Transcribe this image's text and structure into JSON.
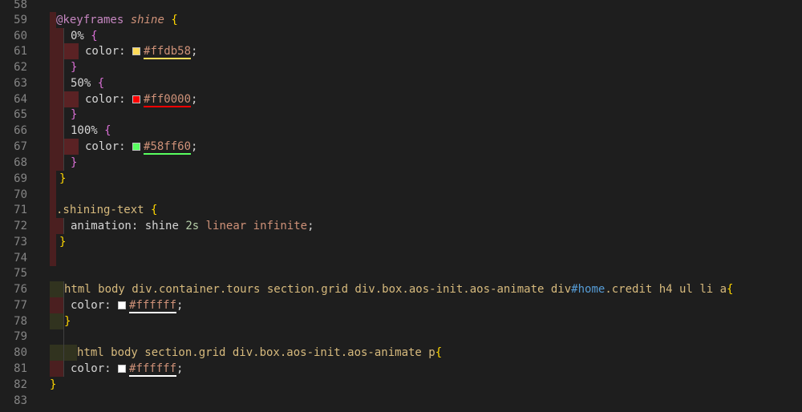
{
  "editor": {
    "lines": [
      {
        "n": "58"
      },
      {
        "n": "59",
        "t": {
          "at": "@keyframes",
          "name": "shine",
          "open": "{"
        }
      },
      {
        "n": "60",
        "t": {
          "sel": "0%",
          "open": "{"
        }
      },
      {
        "n": "61",
        "t": {
          "prop": "color:",
          "value": "#ffdb58",
          "semi": ";"
        }
      },
      {
        "n": "62",
        "t": {
          "close": "}"
        }
      },
      {
        "n": "63",
        "t": {
          "sel": "50%",
          "open": "{"
        }
      },
      {
        "n": "64",
        "t": {
          "prop": "color:",
          "value": "#ff0000",
          "semi": ";"
        }
      },
      {
        "n": "65",
        "t": {
          "close": "}"
        }
      },
      {
        "n": "66",
        "t": {
          "sel": "100%",
          "open": "{"
        }
      },
      {
        "n": "67",
        "t": {
          "prop": "color:",
          "value": "#58ff60",
          "semi": ";"
        }
      },
      {
        "n": "68",
        "t": {
          "close": "}"
        }
      },
      {
        "n": "69",
        "t": {
          "close": "}"
        }
      },
      {
        "n": "70"
      },
      {
        "n": "71",
        "t": {
          "sel": ".shining-text",
          "open": "{"
        }
      },
      {
        "n": "72",
        "t": {
          "prop": "animation:",
          "v1": "shine",
          "v2": "2s",
          "v3": "linear",
          "v4": "infinite",
          "semi": ";"
        }
      },
      {
        "n": "73",
        "t": {
          "close": "}"
        }
      },
      {
        "n": "74"
      },
      {
        "n": "75"
      },
      {
        "n": "76",
        "t": {
          "s1": "html body div.container.tours section.grid div.box.aos-init.aos-animate div",
          "s2": "#home",
          "s3": ".credit h4 ul li a",
          "open": "{"
        }
      },
      {
        "n": "77",
        "t": {
          "prop": "color:",
          "value": "#ffffff",
          "semi": ";"
        }
      },
      {
        "n": "78",
        "t": {
          "close": "}"
        }
      },
      {
        "n": "79"
      },
      {
        "n": "80",
        "t": {
          "s1": "html body section.grid div.box.aos-init.aos-animate p",
          "open": "{"
        }
      },
      {
        "n": "81",
        "t": {
          "prop": "color:",
          "value": "#ffffff",
          "semi": ";"
        }
      },
      {
        "n": "82",
        "t": {
          "close": "}"
        }
      },
      {
        "n": "83"
      }
    ]
  },
  "colors": {
    "background": "#1e1e1e",
    "line_number": "#858585",
    "swatch_yellow": "#ffdb58",
    "swatch_red": "#ff0000",
    "swatch_green": "#58ff60",
    "swatch_white": "#ffffff"
  }
}
